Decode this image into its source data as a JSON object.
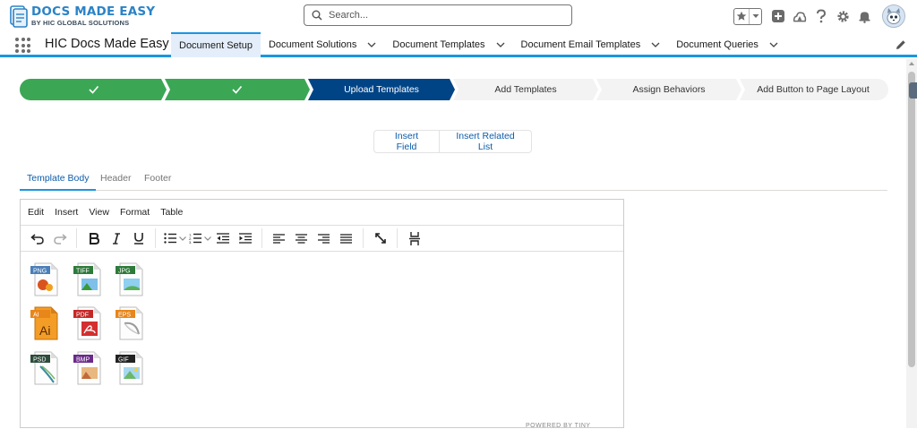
{
  "header": {
    "logo_title": "DOCS MADE EASY",
    "logo_subtitle": "BY HIC GLOBAL SOLUTIONS",
    "search_placeholder": "Search...",
    "icons": [
      "star-icon",
      "chevron-down-icon",
      "add-icon",
      "trailhead-icon",
      "help-icon",
      "setup-gear-icon",
      "notifications-bell-icon",
      "avatar-icon"
    ]
  },
  "nav": {
    "app_name": "HIC Docs Made Easy",
    "tabs": [
      {
        "label": "Document Setup",
        "active": true,
        "has_menu": false
      },
      {
        "label": "Document Solutions",
        "active": false,
        "has_menu": true
      },
      {
        "label": "Document Templates",
        "active": false,
        "has_menu": true
      },
      {
        "label": "Document Email Templates",
        "active": false,
        "has_menu": true
      },
      {
        "label": "Document Queries",
        "active": false,
        "has_menu": true
      }
    ]
  },
  "path": {
    "steps": [
      {
        "label": "",
        "status": "complete",
        "icon": "check-icon"
      },
      {
        "label": "",
        "status": "complete",
        "icon": "check-icon"
      },
      {
        "label": "Upload Templates",
        "status": "current"
      },
      {
        "label": "Add Templates",
        "status": "incomplete"
      },
      {
        "label": "Assign Behaviors",
        "status": "incomplete"
      },
      {
        "label": "Add Button to Page Layout",
        "status": "incomplete"
      }
    ],
    "colors": {
      "complete": "#3ba755",
      "current": "#014486",
      "incomplete": "#f3f3f3"
    }
  },
  "actions": {
    "insert_field": "Insert Field",
    "insert_related_list": "Insert Related List"
  },
  "template_tabs": [
    {
      "label": "Template Body",
      "active": true
    },
    {
      "label": "Header",
      "active": false
    },
    {
      "label": "Footer",
      "active": false
    }
  ],
  "editor": {
    "menu": [
      "Edit",
      "Insert",
      "View",
      "Format",
      "Table"
    ],
    "toolbar": [
      "undo-icon",
      "redo-icon",
      "bold-icon",
      "italic-icon",
      "underline-icon",
      "bullet-list-icon",
      "numbered-list-icon",
      "outdent-icon",
      "indent-icon",
      "align-left-icon",
      "align-center-icon",
      "align-right-icon",
      "align-justify-icon",
      "fullscreen-icon",
      "page-break-icon"
    ],
    "files": [
      {
        "label": "PNG",
        "color": "#4a7fb8"
      },
      {
        "label": "TIFF",
        "color": "#2d7a3a"
      },
      {
        "label": "JPG",
        "color": "#2d7a3a"
      },
      {
        "label": "AI",
        "color": "#e8861a"
      },
      {
        "label": "PDF",
        "color": "#c62828"
      },
      {
        "label": "EPS",
        "color": "#e8861a"
      },
      {
        "label": "PSD",
        "color": "#2e4b3c"
      },
      {
        "label": "BMP",
        "color": "#6a2a8a"
      },
      {
        "label": "GIF",
        "color": "#222222"
      }
    ],
    "powered_by": "POWERED BY TINY"
  }
}
